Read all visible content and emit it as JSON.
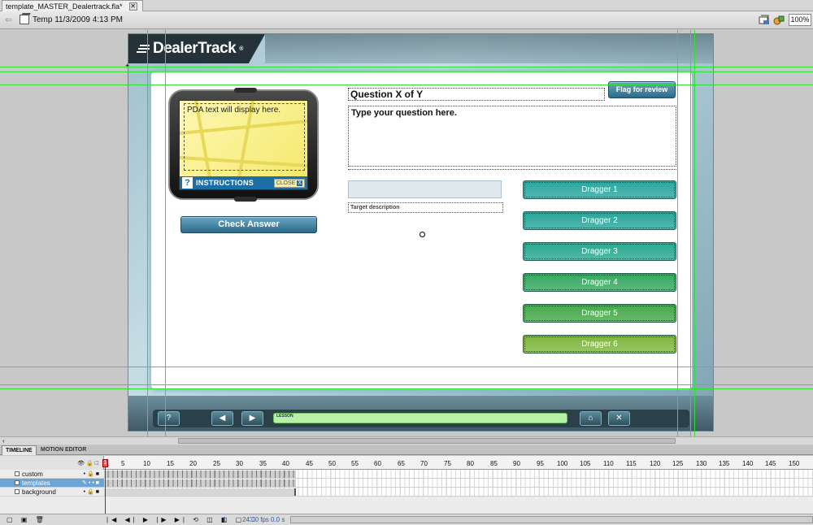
{
  "document": {
    "tab_title": "template_MASTER_Dealertrack.fla*",
    "tab_close": "✕",
    "scene_label": "Temp 11/3/2009 4:13 PM",
    "zoom": "100%"
  },
  "stage": {
    "logo_text": "DealerTrack",
    "logo_tm": "®",
    "pda": {
      "text": "PDA text will display here.",
      "help_glyph": "?",
      "instructions_label": "INSTRUCTIONS",
      "close_label": "CLOSE",
      "close_x": "X"
    },
    "check_answer": "Check Answer",
    "flag_for_review": "Flag for review",
    "question_title": "Question X of Y",
    "question_body": "Type your question here.",
    "target_description": "Target description",
    "draggers": [
      {
        "label": "Dragger 1",
        "color": "#2aa6a0"
      },
      {
        "label": "Dragger 2",
        "color": "#29a59a"
      },
      {
        "label": "Dragger 3",
        "color": "#2aa890"
      },
      {
        "label": "Dragger 4",
        "color": "#35a85f"
      },
      {
        "label": "Dragger 5",
        "color": "#45a849"
      },
      {
        "label": "Dragger 6",
        "color": "#7fb63d"
      }
    ],
    "nav": {
      "help": "?",
      "prev": "◀",
      "next": "▶",
      "lesson_label": "LESSON",
      "home": "⌂",
      "exit": "✕"
    }
  },
  "timeline": {
    "tabs": [
      "TIMELINE",
      "MOTION EDITOR"
    ],
    "frame_numbers": [
      "1",
      "5",
      "10",
      "15",
      "20",
      "25",
      "30",
      "35",
      "40",
      "45",
      "50",
      "55",
      "60",
      "65",
      "70",
      "75",
      "80",
      "85",
      "90",
      "95",
      "100",
      "105",
      "110",
      "115",
      "120",
      "125",
      "130",
      "135",
      "140",
      "145",
      "150"
    ],
    "layers": [
      {
        "name": "custom",
        "selected": false
      },
      {
        "name": "templates",
        "selected": true
      },
      {
        "name": "background",
        "selected": false
      }
    ],
    "current_frame": "1",
    "fps": "24.00 fps",
    "time": "0.0 s"
  }
}
